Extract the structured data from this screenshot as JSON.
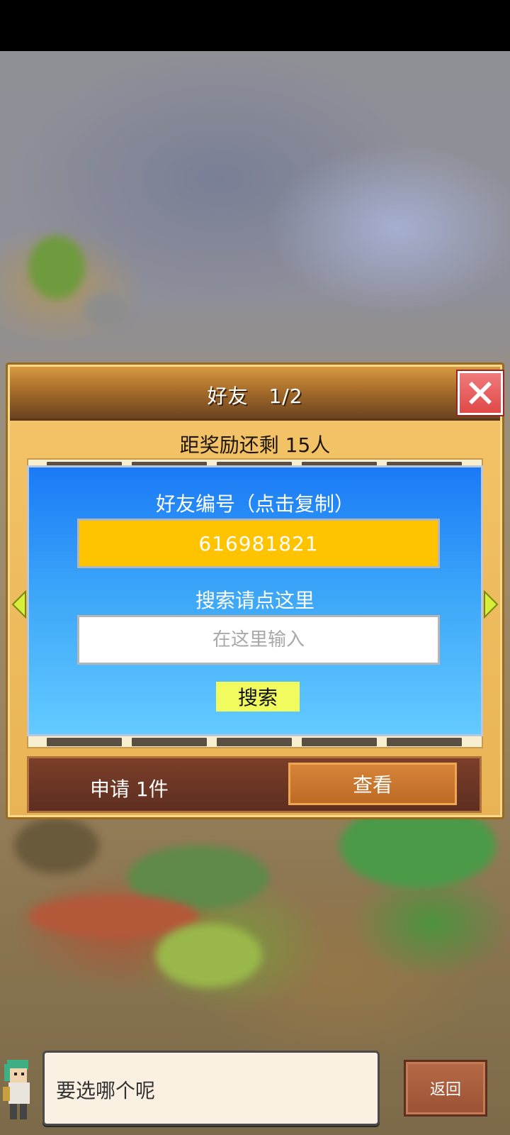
{
  "dialog": {
    "title": "好友　1/2",
    "reward_text": "距奖励还剩 15人"
  },
  "friend_panel": {
    "id_label": "好友编号（点击复制）",
    "id_value": "616981821",
    "search_label": "搜索请点这里",
    "search_placeholder": "在这里输入",
    "search_button": "搜索"
  },
  "requests": {
    "text": "申请 1件",
    "view_button": "查看"
  },
  "footer": {
    "message": "要选哪个呢",
    "back_button": "返回"
  },
  "colors": {
    "dialog_bg": "#f5c56a",
    "panel_blue_top": "#1a7af6",
    "panel_blue_bottom": "#63cbff",
    "id_box": "#ffc300",
    "search_button": "#f2fb5e",
    "close_button": "#e04848",
    "request_bar": "#6b3424",
    "view_button": "#c9742c"
  },
  "icons": [
    "close-icon",
    "arrow-left-icon",
    "arrow-right-icon",
    "character-avatar"
  ]
}
